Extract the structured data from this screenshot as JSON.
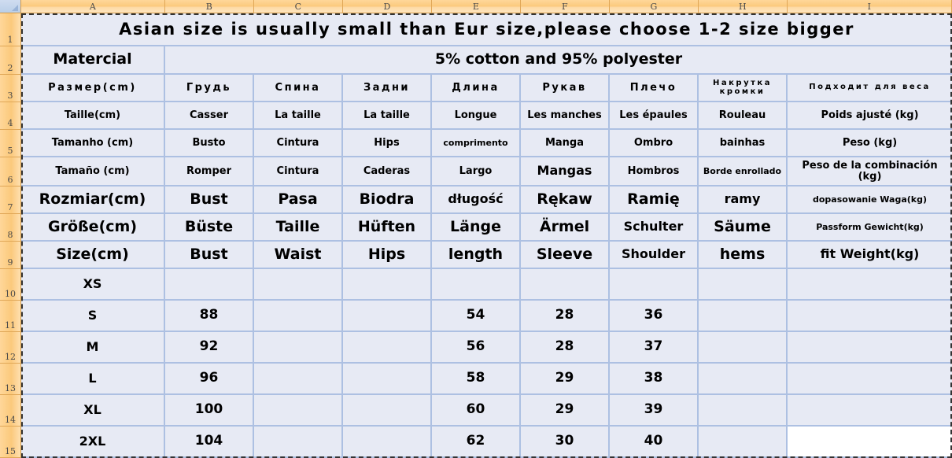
{
  "spreadsheet": {
    "column_headers": [
      "A",
      "B",
      "C",
      "D",
      "E",
      "F",
      "G",
      "H",
      "I"
    ],
    "row_headers": [
      "1",
      "2",
      "3",
      "4",
      "5",
      "6",
      "7",
      "8",
      "9",
      "10",
      "11",
      "12",
      "13",
      "14",
      "15"
    ],
    "colors": {
      "cell_fill": "#e7eaf4",
      "grid_line": "#adc0e2",
      "header_fill": "#fbc97c",
      "header_text": "#4a4a4a",
      "corner_fill": "#bacfe8"
    }
  },
  "rows": {
    "r1": {
      "banner": "Asian size is usually small than Eur size,please choose 1-2 size bigger"
    },
    "r2": {
      "label": "Matercial",
      "value": "5% cotton and 95% polyester"
    },
    "r3_russian": {
      "a": "Размер(cm)",
      "b": "Грудь",
      "c": "Спина",
      "d": "Задни",
      "e": "Длина",
      "f": "Рукав",
      "g": "Плечо",
      "h": "Накрутка кромки",
      "i": "Подходит для веса"
    },
    "r4_french": {
      "a": "Taille(cm)",
      "b": "Casser",
      "c": "La taille",
      "d": "La taille",
      "e": "Longue",
      "f": "Les manches",
      "g": "Les épaules",
      "h": "Rouleau",
      "i": "Poids ajusté (kg)"
    },
    "r5_portuguese": {
      "a": "Tamanho (cm)",
      "b": "Busto",
      "c": "Cintura",
      "d": "Hips",
      "e": "comprimento",
      "f": "Manga",
      "g": "Ombro",
      "h": "bainhas",
      "i": "Peso (kg)"
    },
    "r6_spanish": {
      "a": "Tamaño (cm)",
      "b": "Romper",
      "c": "Cintura",
      "d": "Caderas",
      "e": "Largo",
      "f": "Mangas",
      "g": "Hombros",
      "h": "Borde enrollado",
      "i": "Peso de la combinación (kg)"
    },
    "r7_polish": {
      "a": "Rozmiar(cm)",
      "b": "Bust",
      "c": "Pasa",
      "d": "Biodra",
      "e": "długość",
      "f": "Rękaw",
      "g": "Ramię",
      "h": "ramy",
      "i": "dopasowanie Waga(kg)"
    },
    "r8_german": {
      "a": "Größe(cm)",
      "b": "Büste",
      "c": "Taille",
      "d": "Hüften",
      "e": "Länge",
      "f": "Ärmel",
      "g": "Schulter",
      "h": "Säume",
      "i": "Passform Gewicht(kg)"
    },
    "r9_english": {
      "a": "Size(cm)",
      "b": "Bust",
      "c": "Waist",
      "d": "Hips",
      "e": "length",
      "f": "Sleeve",
      "g": "Shoulder",
      "h": "hems",
      "i": "fit Weight(kg)"
    }
  },
  "size_table": {
    "columns": [
      "Size(cm)",
      "Bust",
      "Waist",
      "Hips",
      "length",
      "Sleeve",
      "Shoulder",
      "hems",
      "fit Weight(kg)"
    ],
    "data": [
      {
        "size": "XS",
        "bust": "",
        "waist": "",
        "hips": "",
        "length": "",
        "sleeve": "",
        "shoulder": "",
        "hems": "",
        "fit_weight": ""
      },
      {
        "size": "S",
        "bust": "88",
        "waist": "",
        "hips": "",
        "length": "54",
        "sleeve": "28",
        "shoulder": "36",
        "hems": "",
        "fit_weight": ""
      },
      {
        "size": "M",
        "bust": "92",
        "waist": "",
        "hips": "",
        "length": "56",
        "sleeve": "28",
        "shoulder": "37",
        "hems": "",
        "fit_weight": ""
      },
      {
        "size": "L",
        "bust": "96",
        "waist": "",
        "hips": "",
        "length": "58",
        "sleeve": "29",
        "shoulder": "38",
        "hems": "",
        "fit_weight": ""
      },
      {
        "size": "XL",
        "bust": "100",
        "waist": "",
        "hips": "",
        "length": "60",
        "sleeve": "29",
        "shoulder": "39",
        "hems": "",
        "fit_weight": ""
      },
      {
        "size": "2XL",
        "bust": "104",
        "waist": "",
        "hips": "",
        "length": "62",
        "sleeve": "30",
        "shoulder": "40",
        "hems": "",
        "fit_weight": ""
      }
    ]
  }
}
